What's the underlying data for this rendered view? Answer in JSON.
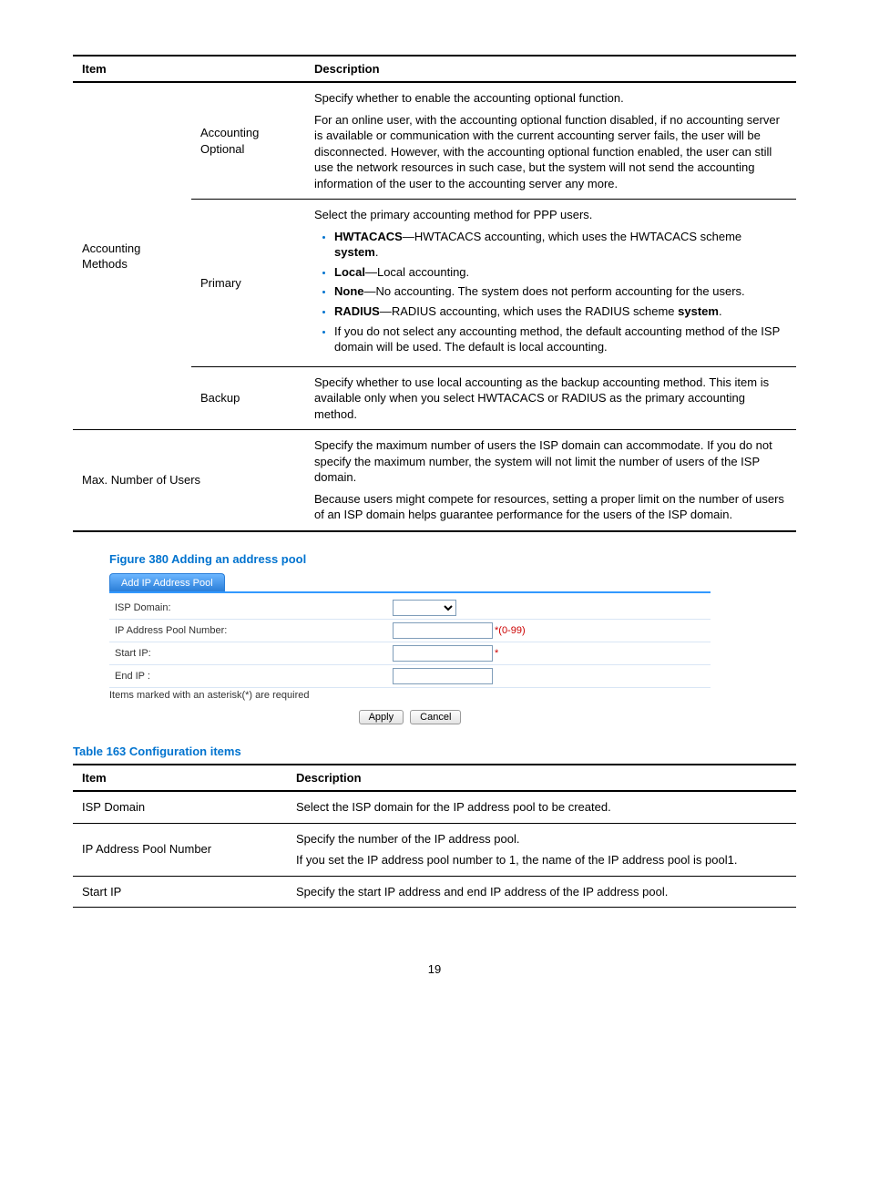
{
  "table1": {
    "header": {
      "item": "Item",
      "desc": "Description"
    },
    "accounting_methods_label": "Accounting Methods",
    "accounting_optional": {
      "sublabel": "Accounting Optional",
      "p1": "Specify whether to enable the accounting optional function.",
      "p2": "For an online user, with the accounting optional function disabled, if no accounting server is available or communication with the current accounting server fails, the user will be disconnected. However, with the accounting optional function enabled, the user can still use the network resources in such case, but the system will not send the accounting information of the user to the accounting server any more."
    },
    "primary": {
      "sublabel": "Primary",
      "p1": "Select the primary accounting method for PPP users.",
      "li1_b": "HWTACACS",
      "li1": "—HWTACACS accounting, which uses the HWTACACS scheme ",
      "li1_b2": "system",
      "li1_tail": ".",
      "li2_b": "Local",
      "li2": "—Local accounting.",
      "li3_b": "None",
      "li3": "—No accounting. The system does not perform accounting for the users.",
      "li4_b": "RADIUS",
      "li4": "—RADIUS accounting, which uses the RADIUS scheme ",
      "li4_b2": "system",
      "li4_tail": ".",
      "li5": "If you do not select any accounting method, the default accounting method of the ISP domain will be used. The default is local accounting."
    },
    "backup": {
      "sublabel": "Backup",
      "p1": "Specify whether to use local accounting as the backup accounting method. This item is available only when you select HWTACACS or RADIUS as the primary accounting method."
    },
    "maxusers": {
      "label": "Max. Number of Users",
      "p1": "Specify the maximum number of users the ISP domain can accommodate. If you do not specify the maximum number, the system will not limit the number of users of the ISP domain.",
      "p2": "Because users might compete for resources, setting a proper limit on the number of users of an ISP domain helps guarantee performance for the users of the ISP domain."
    }
  },
  "figure_caption": "Figure 380 Adding an address pool",
  "form": {
    "tab": "Add IP Address Pool",
    "isp_domain": "ISP Domain:",
    "pool_num": "IP Address Pool Number:",
    "pool_range": "*(0-99)",
    "start_ip": "Start IP:",
    "star": "*",
    "end_ip": "End IP :",
    "note": "Items marked with an asterisk(*) are required",
    "apply": "Apply",
    "cancel": "Cancel"
  },
  "table2_caption": "Table 163 Configuration items",
  "table2": {
    "header": {
      "item": "Item",
      "desc": "Description"
    },
    "row1": {
      "item": "ISP Domain",
      "desc": "Select the ISP domain for the IP address pool to be created."
    },
    "row2": {
      "item": "IP Address Pool Number",
      "p1": "Specify the number of the IP address pool.",
      "p2": "If you set the IP address pool number to 1, the name of the IP address pool is pool1."
    },
    "row3": {
      "item": "Start IP",
      "desc": "Specify the start IP address and end IP address of the IP address pool."
    }
  },
  "page_number": "19"
}
